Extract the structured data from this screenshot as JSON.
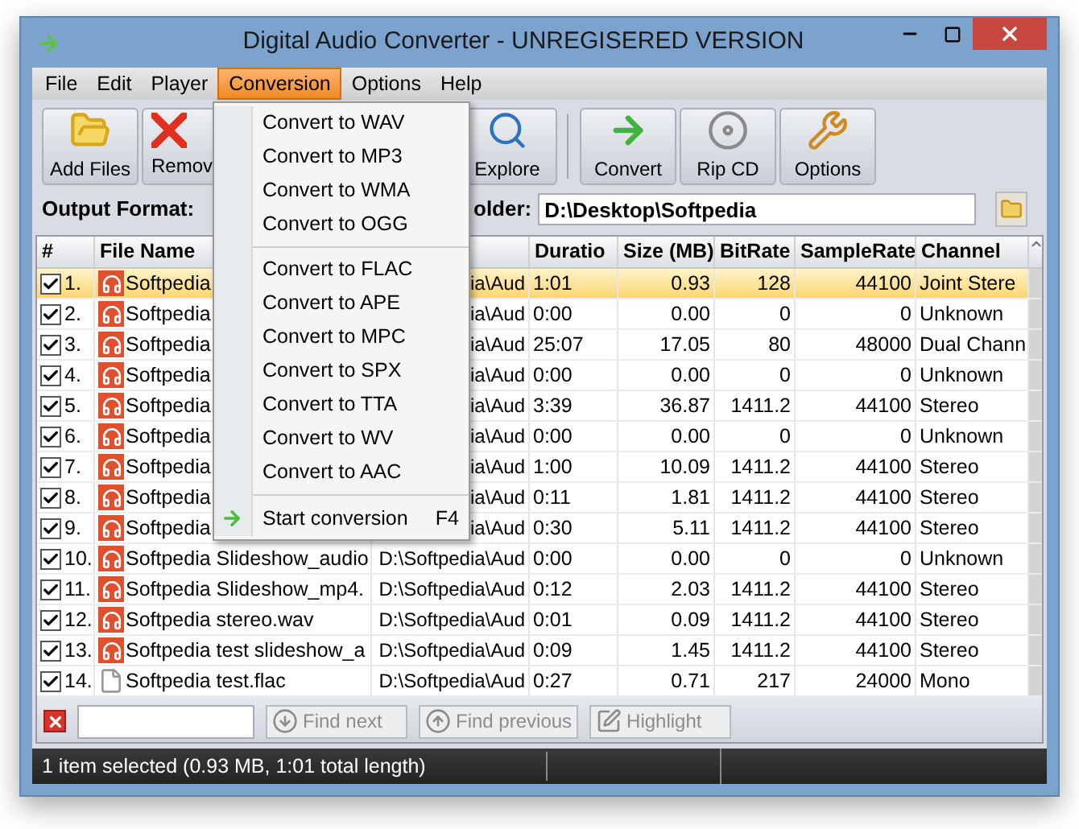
{
  "window": {
    "title": "Digital Audio Converter - UNREGISERED VERSION"
  },
  "menu_bar": [
    {
      "label": "File",
      "selected": false
    },
    {
      "label": "Edit",
      "selected": false
    },
    {
      "label": "Player",
      "selected": false
    },
    {
      "label": "Conversion",
      "selected": true
    },
    {
      "label": "Options",
      "selected": false
    },
    {
      "label": "Help",
      "selected": false
    }
  ],
  "toolbar": [
    {
      "label": "Add Files",
      "kind": "add"
    },
    {
      "label": "Remov",
      "kind": "remove"
    },
    {
      "label": "Explore",
      "kind": "explore"
    },
    {
      "label": "Convert",
      "kind": "convert"
    },
    {
      "label": "Rip CD",
      "kind": "rip"
    },
    {
      "label": "Options",
      "kind": "options"
    }
  ],
  "output": {
    "format_label": "Output Format:",
    "folder_label": "older:",
    "folder_value": "D:\\Desktop\\Softpedia"
  },
  "dropdown_menu": [
    {
      "label": "Convert to WAV",
      "kind": "item"
    },
    {
      "label": "Convert to MP3",
      "kind": "item"
    },
    {
      "label": "Convert to WMA",
      "kind": "item"
    },
    {
      "label": "Convert to OGG",
      "kind": "item"
    },
    {
      "kind": "separator"
    },
    {
      "label": "Convert to FLAC",
      "kind": "item"
    },
    {
      "label": "Convert to APE",
      "kind": "item"
    },
    {
      "label": "Convert to MPC",
      "kind": "item"
    },
    {
      "label": "Convert to SPX",
      "kind": "item"
    },
    {
      "label": "Convert to TTA",
      "kind": "item"
    },
    {
      "label": "Convert to WV",
      "kind": "item"
    },
    {
      "label": "Convert to AAC",
      "kind": "item"
    },
    {
      "kind": "separator"
    },
    {
      "label": "Start conversion",
      "shortcut": "F4",
      "kind": "start"
    }
  ],
  "table": {
    "columns": [
      "#",
      "File Name",
      "Duratio",
      "Size (MB)",
      "BitRate",
      "SampleRate",
      "Channel"
    ],
    "rows": [
      {
        "num": "1.",
        "checked": true,
        "selected": true,
        "kind": "audio",
        "name": "Softpedia",
        "path": "ia\\Aud",
        "duration": "1:01",
        "size": "0.93",
        "bitrate": "128",
        "samplerate": "44100",
        "channel": "Joint Stere"
      },
      {
        "num": "2.",
        "checked": true,
        "selected": false,
        "kind": "audio",
        "name": "Softpedia",
        "path": "ia\\Aud",
        "duration": "0:00",
        "size": "0.00",
        "bitrate": "0",
        "samplerate": "0",
        "channel": "Unknown"
      },
      {
        "num": "3.",
        "checked": true,
        "selected": false,
        "kind": "audio",
        "name": "Softpedia",
        "path": "ia\\Aud",
        "duration": "25:07",
        "size": "17.05",
        "bitrate": "80",
        "samplerate": "48000",
        "channel": "Dual Chann"
      },
      {
        "num": "4.",
        "checked": true,
        "selected": false,
        "kind": "audio",
        "name": "Softpedia",
        "path": "ia\\Aud",
        "duration": "0:00",
        "size": "0.00",
        "bitrate": "0",
        "samplerate": "0",
        "channel": "Unknown"
      },
      {
        "num": "5.",
        "checked": true,
        "selected": false,
        "kind": "audio",
        "name": "Softpedia",
        "path": "ia\\Aud",
        "duration": "3:39",
        "size": "36.87",
        "bitrate": "1411.2",
        "samplerate": "44100",
        "channel": "Stereo"
      },
      {
        "num": "6.",
        "checked": true,
        "selected": false,
        "kind": "audio",
        "name": "Softpedia",
        "path": "ia\\Aud",
        "duration": "0:00",
        "size": "0.00",
        "bitrate": "0",
        "samplerate": "0",
        "channel": "Unknown"
      },
      {
        "num": "7.",
        "checked": true,
        "selected": false,
        "kind": "audio",
        "name": "Softpedia",
        "path": "ia\\Aud",
        "duration": "1:00",
        "size": "10.09",
        "bitrate": "1411.2",
        "samplerate": "44100",
        "channel": "Stereo"
      },
      {
        "num": "8.",
        "checked": true,
        "selected": false,
        "kind": "audio",
        "name": "Softpedia",
        "path": "ia\\Aud",
        "duration": "0:11",
        "size": "1.81",
        "bitrate": "1411.2",
        "samplerate": "44100",
        "channel": "Stereo"
      },
      {
        "num": "9.",
        "checked": true,
        "selected": false,
        "kind": "audio",
        "name": "Softpedia",
        "path": "ia\\Aud",
        "duration": "0:30",
        "size": "5.11",
        "bitrate": "1411.2",
        "samplerate": "44100",
        "channel": "Stereo"
      },
      {
        "num": "10.",
        "checked": true,
        "selected": false,
        "kind": "audio",
        "name": "Softpedia Slideshow_audio",
        "path": "D:\\Softpedia\\Aud",
        "duration": "0:00",
        "size": "0.00",
        "bitrate": "0",
        "samplerate": "0",
        "channel": "Unknown"
      },
      {
        "num": "11.",
        "checked": true,
        "selected": false,
        "kind": "audio",
        "name": "Softpedia Slideshow_mp4.",
        "path": "D:\\Softpedia\\Aud",
        "duration": "0:12",
        "size": "2.03",
        "bitrate": "1411.2",
        "samplerate": "44100",
        "channel": "Stereo"
      },
      {
        "num": "12.",
        "checked": true,
        "selected": false,
        "kind": "audio",
        "name": "Softpedia stereo.wav",
        "path": "D:\\Softpedia\\Aud",
        "duration": "0:01",
        "size": "0.09",
        "bitrate": "1411.2",
        "samplerate": "44100",
        "channel": "Stereo"
      },
      {
        "num": "13.",
        "checked": true,
        "selected": false,
        "kind": "audio",
        "name": "Softpedia test slideshow_a",
        "path": "D:\\Softpedia\\Aud",
        "duration": "0:09",
        "size": "1.45",
        "bitrate": "1411.2",
        "samplerate": "44100",
        "channel": "Stereo"
      },
      {
        "num": "14.",
        "checked": true,
        "selected": false,
        "kind": "file",
        "name": "Softpedia test.flac",
        "path": "D:\\Softpedia\\Aud",
        "duration": "0:27",
        "size": "0.71",
        "bitrate": "217",
        "samplerate": "24000",
        "channel": "Mono"
      }
    ]
  },
  "find_bar": {
    "buttons": [
      {
        "label": "Find next",
        "kind": "next",
        "disabled": true
      },
      {
        "label": "Find previous",
        "kind": "previous",
        "disabled": true
      },
      {
        "label": "Highlight",
        "kind": "highlight",
        "disabled": true
      }
    ]
  },
  "status_bar": {
    "text": "1 item selected (0.93 MB, 1:01 total length)"
  }
}
